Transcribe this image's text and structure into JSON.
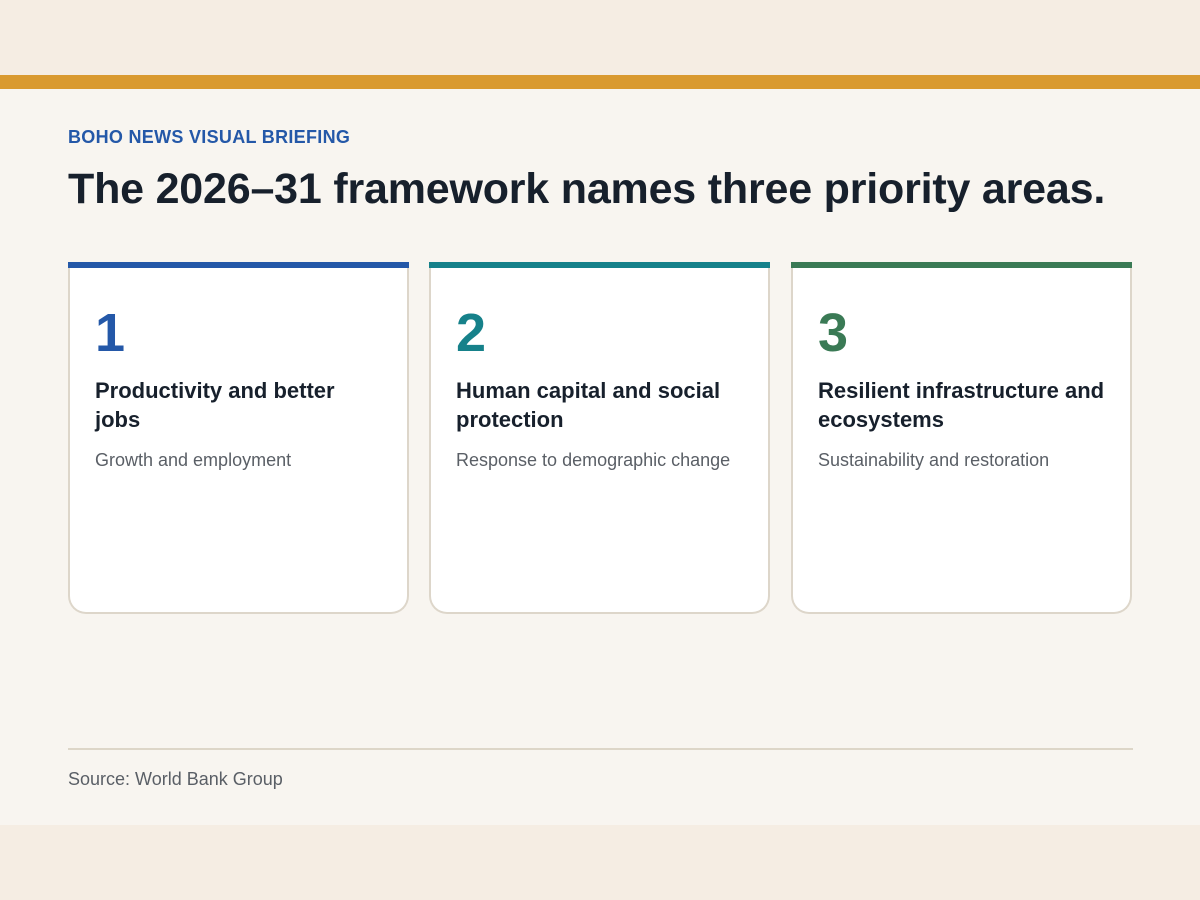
{
  "header": {
    "kicker": "BOHO NEWS VISUAL BRIEFING",
    "title": "The 2026–31 framework names three priority areas."
  },
  "cards": [
    {
      "number": "1",
      "title": "Productivity and better jobs",
      "subtitle": "Growth and employment",
      "color": "#2458a8"
    },
    {
      "number": "2",
      "title": "Human capital and social protection",
      "subtitle": "Response to demographic change",
      "color": "#16818a"
    },
    {
      "number": "3",
      "title": "Resilient infrastructure and ecosystems",
      "subtitle": "Sustainability and restoration",
      "color": "#3a7a55"
    }
  ],
  "footer": {
    "source": "Source: World Bank Group"
  },
  "colors": {
    "accent_bar": "#d99a30",
    "background": "#f8f5f0",
    "outer_band": "#f5ede3"
  }
}
